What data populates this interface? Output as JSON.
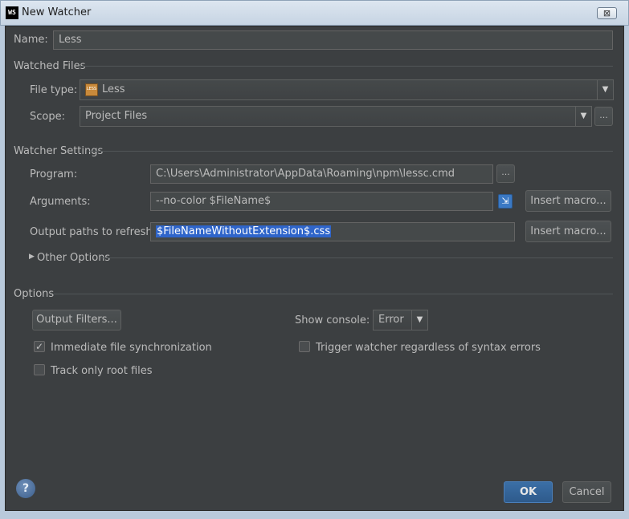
{
  "window": {
    "app_icon_text": "WS",
    "title": "New Watcher",
    "close_glyph": "⊠"
  },
  "name": {
    "label": "Name:",
    "value": "Less"
  },
  "watched_files": {
    "section": "Watched Files",
    "file_type_label": "File type:",
    "file_type_value": "Less",
    "file_type_icon_text": "LESS",
    "scope_label": "Scope:",
    "scope_value": "Project Files",
    "browse": "..."
  },
  "watcher_settings": {
    "section": "Watcher Settings",
    "program_label": "Program:",
    "program_value": "C:\\Users\\Administrator\\AppData\\Roaming\\npm\\lessc.cmd",
    "arguments_label": "Arguments:",
    "arguments_value": "--no-color $FileName$",
    "output_label": "Output paths to refresh:",
    "output_value": "$FileNameWithoutExtension$.css",
    "insert_macro": "Insert macro...",
    "other_options": "Other Options",
    "browse": "..."
  },
  "options": {
    "section": "Options",
    "output_filters": "Output Filters...",
    "show_console_label": "Show console:",
    "show_console_value": "Error",
    "immediate_sync": "Immediate file synchronization",
    "immediate_sync_checked": true,
    "track_root": "Track only root files",
    "track_root_checked": false,
    "trigger_errors": "Trigger watcher regardless of syntax errors",
    "trigger_errors_checked": false
  },
  "footer": {
    "help": "?",
    "ok": "OK",
    "cancel": "Cancel"
  },
  "colors": {
    "dialog_bg": "#3c3f41",
    "field_bg": "#45494a",
    "selection": "#2f65ca",
    "ok_button": "#365f91"
  }
}
